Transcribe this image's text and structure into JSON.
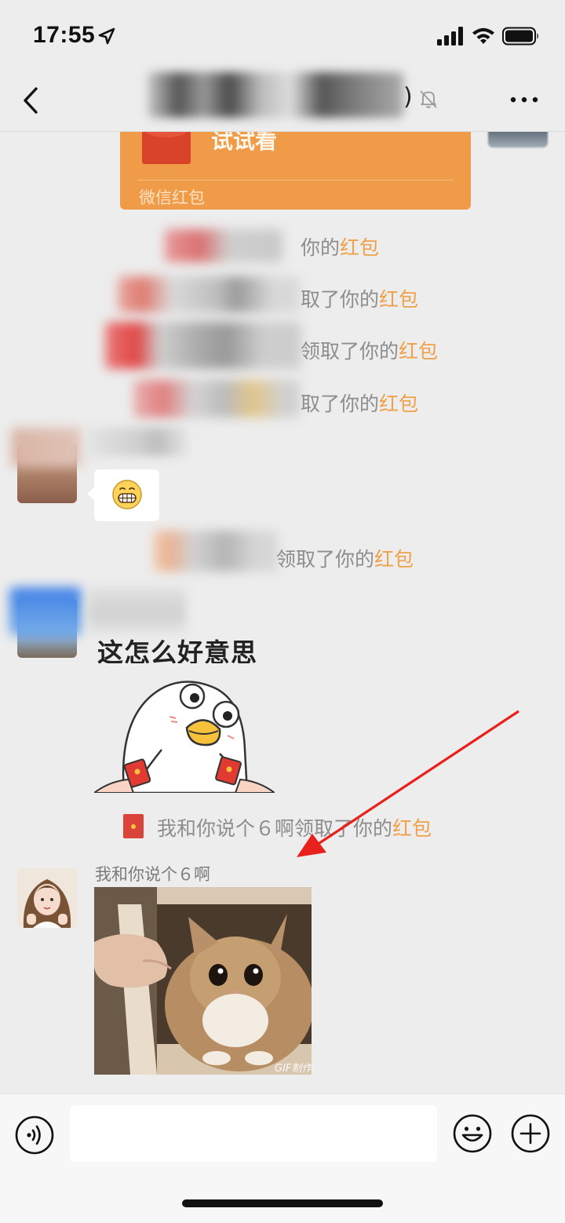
{
  "status_bar": {
    "time": "17:55"
  },
  "nav": {
    "title_suffix": ")",
    "icons": [
      "back-icon",
      "mute-icon",
      "more-icon"
    ]
  },
  "red_packet": {
    "text": "试试看",
    "footer": "微信红包",
    "color": "#f09b48"
  },
  "system_messages": [
    {
      "prefix": "你的",
      "highlight": "红包"
    },
    {
      "prefix": "取了你的",
      "highlight": "红包"
    },
    {
      "prefix": "领取了你的",
      "highlight": "红包"
    },
    {
      "prefix": "取了你的",
      "highlight": "红包"
    },
    {
      "prefix": "领取了你的",
      "highlight": "红包"
    },
    {
      "prefix": "我和你说个６啊领取了你的",
      "highlight": "红包"
    }
  ],
  "sticker": {
    "text": "这怎么好意思"
  },
  "last_message": {
    "sender": "我和你说个６啊",
    "gif_label": "GIF制作"
  },
  "colors": {
    "highlight": "#f0a048",
    "arrow": "#e8211c"
  }
}
